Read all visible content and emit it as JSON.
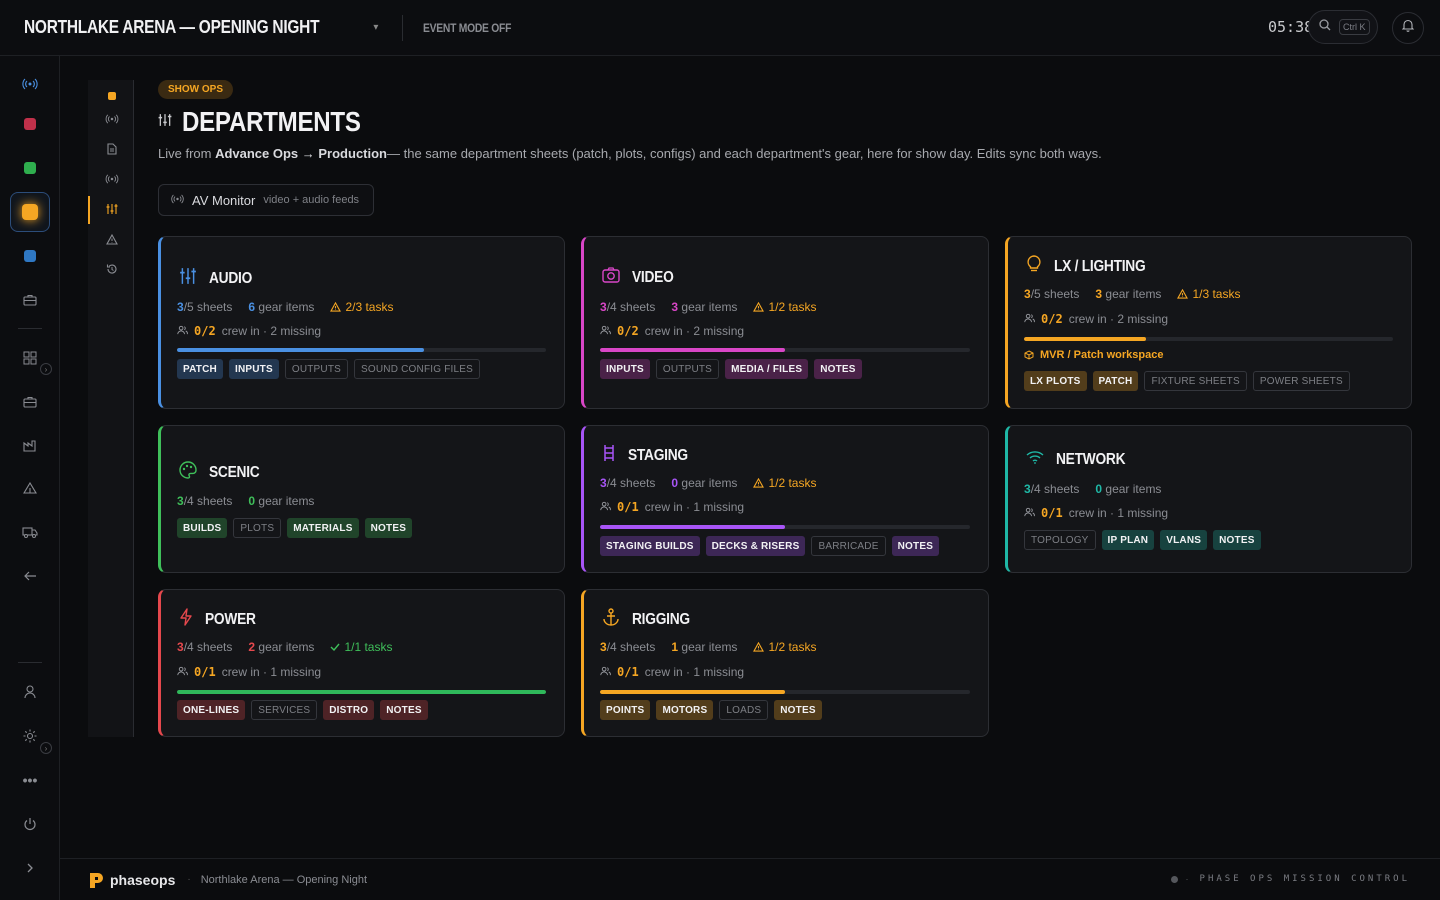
{
  "header": {
    "title": "NORTHLAKE ARENA — OPENING NIGHT",
    "event_mode": "EVENT MODE OFF",
    "clock": "05:38",
    "search_shortcut": "Ctrl K"
  },
  "page": {
    "section_badge": "SHOW OPS",
    "title": "DEPARTMENTS",
    "desc_pre": "Live from ",
    "desc_bold": "Advance Ops → Production",
    "desc_post": "— the same department sheets (patch, plots, configs) and each department's gear, here for show day. Edits sync both ways.",
    "av_monitor_label": "AV Monitor",
    "av_monitor_sub": "video + audio feeds"
  },
  "departments": [
    {
      "name": "AUDIO",
      "accent": "#4a90e2",
      "sheets_done": "3",
      "sheets_total": "/5 sheets",
      "gear": "6",
      "gear_label": "gear items",
      "tasks": "2/3 tasks",
      "tasks_ok": false,
      "crew": "0/2",
      "crew_label": "crew in · 2 missing",
      "progress": 0.67,
      "progress_color": "#4a90e2",
      "chips": [
        {
          "t": "PATCH",
          "g": false
        },
        {
          "t": "INPUTS",
          "g": false
        },
        {
          "t": "OUTPUTS",
          "g": true
        },
        {
          "t": "SOUND CONFIG FILES",
          "g": true
        }
      ]
    },
    {
      "name": "VIDEO",
      "accent": "#d946c7",
      "sheets_done": "3",
      "sheets_total": "/4 sheets",
      "gear": "3",
      "gear_label": "gear items",
      "tasks": "1/2 tasks",
      "tasks_ok": false,
      "crew": "0/2",
      "crew_label": "crew in · 2 missing",
      "progress": 0.5,
      "progress_color": "#d946c7",
      "chips": [
        {
          "t": "INPUTS",
          "g": false
        },
        {
          "t": "OUTPUTS",
          "g": true
        },
        {
          "t": "MEDIA / FILES",
          "g": false
        },
        {
          "t": "NOTES",
          "g": false
        }
      ]
    },
    {
      "name": "LX / LIGHTING",
      "accent": "#f5a623",
      "sheets_done": "3",
      "sheets_total": "/5 sheets",
      "gear": "3",
      "gear_label": "gear items",
      "tasks": "1/3 tasks",
      "tasks_ok": false,
      "crew": "0/2",
      "crew_label": "crew in · 2 missing",
      "progress": 0.33,
      "progress_color": "#f5a623",
      "extra": "MVR / Patch workspace",
      "chips": [
        {
          "t": "LX PLOTS",
          "g": false
        },
        {
          "t": "PATCH",
          "g": false
        },
        {
          "t": "FIXTURE SHEETS",
          "g": true
        },
        {
          "t": "POWER SHEETS",
          "g": true
        }
      ]
    },
    {
      "name": "SCENIC",
      "accent": "#3fbf5a",
      "sheets_done": "3",
      "sheets_total": "/4 sheets",
      "gear": "0",
      "gear_label": "gear items",
      "chips": [
        {
          "t": "BUILDS",
          "g": false
        },
        {
          "t": "PLOTS",
          "g": true
        },
        {
          "t": "MATERIALS",
          "g": false
        },
        {
          "t": "NOTES",
          "g": false
        }
      ]
    },
    {
      "name": "STAGING",
      "accent": "#a855f7",
      "sheets_done": "3",
      "sheets_total": "/4 sheets",
      "gear": "0",
      "gear_label": "gear items",
      "tasks": "1/2 tasks",
      "tasks_ok": false,
      "crew": "0/1",
      "crew_label": "crew in · 1 missing",
      "progress": 0.5,
      "progress_color": "#a855f7",
      "chips": [
        {
          "t": "STAGING BUILDS",
          "g": false
        },
        {
          "t": "DECKS & RISERS",
          "g": false
        },
        {
          "t": "BARRICADE",
          "g": true
        },
        {
          "t": "NOTES",
          "g": false
        }
      ]
    },
    {
      "name": "NETWORK",
      "accent": "#1fb8a6",
      "sheets_done": "3",
      "sheets_total": "/4 sheets",
      "gear": "0",
      "gear_label": "gear items",
      "crew": "0/1",
      "crew_label": "crew in · 1 missing",
      "chips": [
        {
          "t": "TOPOLOGY",
          "g": true
        },
        {
          "t": "IP PLAN",
          "g": false
        },
        {
          "t": "VLANS",
          "g": false
        },
        {
          "t": "NOTES",
          "g": false
        }
      ]
    },
    {
      "name": "POWER",
      "accent": "#e5484d",
      "sheets_done": "3",
      "sheets_total": "/4 sheets",
      "gear": "2",
      "gear_label": "gear items",
      "tasks": "1/1 tasks",
      "tasks_ok": true,
      "crew": "0/1",
      "crew_label": "crew in · 1 missing",
      "progress": 1.0,
      "progress_color": "#2fb85a",
      "chips": [
        {
          "t": "ONE-LINES",
          "g": false
        },
        {
          "t": "SERVICES",
          "g": true
        },
        {
          "t": "DISTRO",
          "g": false
        },
        {
          "t": "NOTES",
          "g": false
        }
      ]
    },
    {
      "name": "RIGGING",
      "accent": "#f5a623",
      "sheets_done": "3",
      "sheets_total": "/4 sheets",
      "gear": "1",
      "gear_label": "gear items",
      "tasks": "1/2 tasks",
      "tasks_ok": false,
      "crew": "0/1",
      "crew_label": "crew in · 1 missing",
      "progress": 0.5,
      "progress_color": "#f5a623",
      "chips": [
        {
          "t": "POINTS",
          "g": false
        },
        {
          "t": "MOTORS",
          "g": false
        },
        {
          "t": "LOADS",
          "g": true
        },
        {
          "t": "NOTES",
          "g": false
        }
      ]
    }
  ],
  "footer": {
    "brand": "phaseops",
    "event": "Northlake Arena — Opening Night",
    "tagline": "PHASE OPS MISSION CONTROL"
  },
  "colors": {
    "accent": "#f5a623",
    "warn": "#f5a623",
    "ok": "#3fbf5a"
  }
}
